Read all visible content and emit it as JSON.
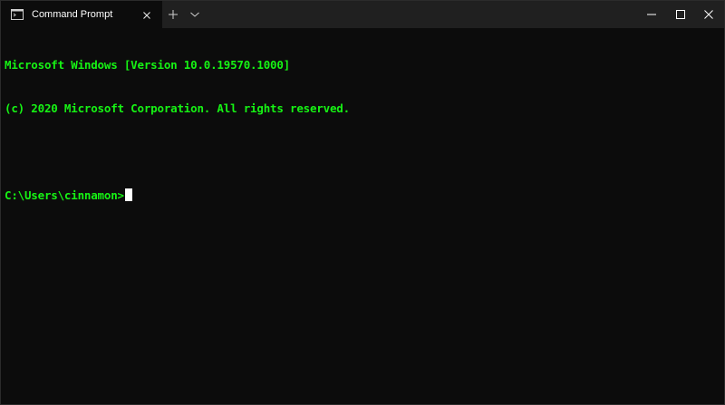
{
  "window": {
    "tab_title": "Command Prompt",
    "tab_icon": "terminal-icon",
    "new_tab_icon": "plus-icon",
    "dropdown_icon": "chevron-down-icon",
    "caption_icons": [
      "minimize-icon",
      "maximize-icon",
      "close-icon"
    ]
  },
  "terminal": {
    "lines": [
      "Microsoft Windows [Version 10.0.19570.1000]",
      "(c) 2020 Microsoft Corporation. All rights reserved.",
      "",
      "C:\\Users\\cinnamon>"
    ],
    "text_color": "#16f314",
    "background_color": "#0c0c0c",
    "cursor_color": "#ffffff"
  },
  "colors": {
    "titlebar": "#202020",
    "active_tab": "#0c0c0c",
    "title_text": "#ffffff"
  }
}
